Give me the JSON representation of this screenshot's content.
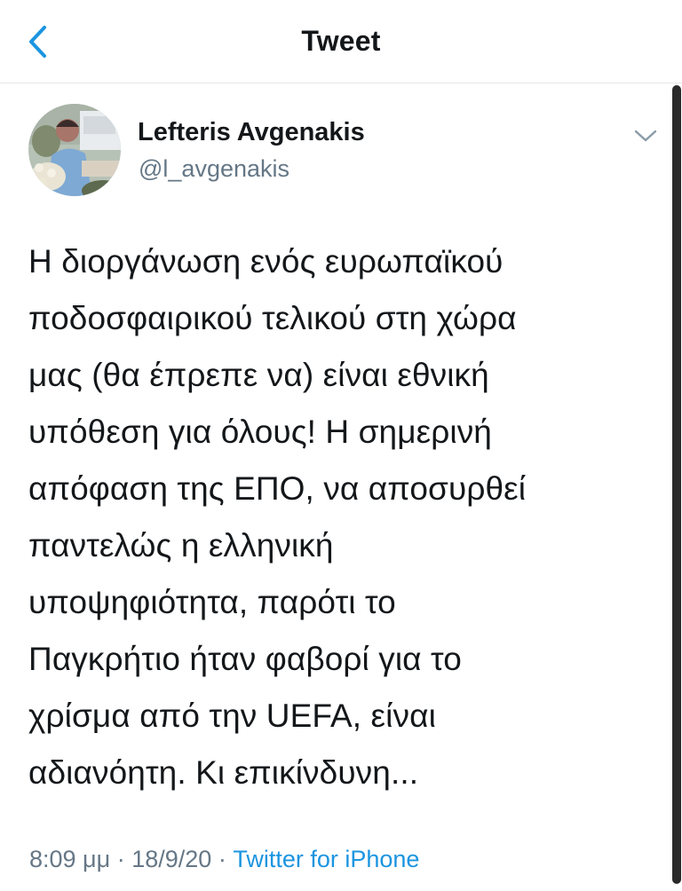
{
  "header": {
    "title": "Tweet"
  },
  "icons": {
    "back": "chevron-left-icon",
    "menu": "chevron-down-icon"
  },
  "colors": {
    "accent": "#1b95e0",
    "secondary_text": "#657786",
    "primary_text": "#14171a"
  },
  "tweet": {
    "author_name": "Lefteris Avgenakis",
    "author_handle": "@l_avgenakis",
    "text": "Η διοργάνωση ενός ευρωπαϊκού\nποδοσφαιρικού τελικού στη χώρα\nμας (θα έπρεπε να) είναι εθνική\nυπόθεση για όλους! Η σημερινή\nαπόφαση της ΕΠΟ, να αποσυρθεί\nπαντελώς η ελληνική\nυποψηφιότητα, παρότι το\nΠαγκρήτιο ήταν φαβορί για το\nχρίσμα από την UEFA, είναι\nαδιανόητη. Κι επικίνδυνη...",
    "time": "8:09 μμ",
    "separator": "·",
    "date": "18/9/20",
    "source": "Twitter for iPhone"
  }
}
